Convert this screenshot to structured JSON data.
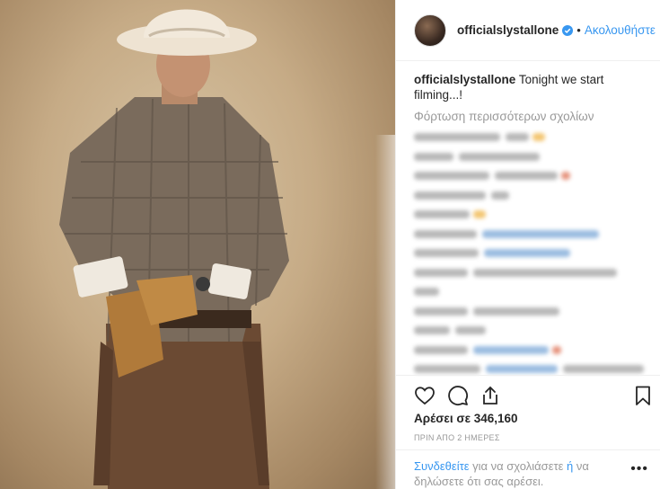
{
  "post": {
    "photo_icon": "portrait-photo"
  },
  "header": {
    "username": "officialslystallone",
    "separator": "•",
    "follow_label": "Ακολουθήστε"
  },
  "caption": {
    "username": "officialslystallone",
    "text": "Tonight we start filming...!"
  },
  "comments": {
    "load_more_label": "Φόρτωση περισσότερων σχολίων"
  },
  "actions": {
    "like_icon": "heart-icon",
    "comment_icon": "comment-icon",
    "share_icon": "share-icon",
    "save_icon": "bookmark-icon"
  },
  "likes": {
    "text": "Αρέσει σε 346,160"
  },
  "timestamp": "ΠΡΙΝ ΑΠΟ 2 ΗΜΕΡΕΣ",
  "footer": {
    "login_link": "Συνδεθείτε",
    "text_mid": " για να σχολιάσετε ",
    "or_link": "ή",
    "text_end": " να δηλώσετε ότι σας αρέσει.",
    "more_label": "•••"
  },
  "colors": {
    "link": "#3897f0",
    "muted": "#999999",
    "text": "#262626",
    "border": "#efefef"
  }
}
